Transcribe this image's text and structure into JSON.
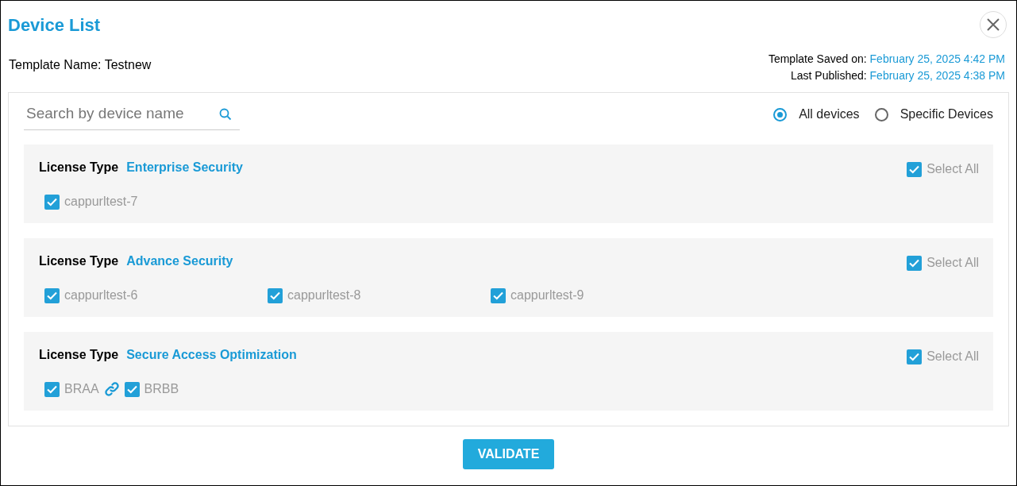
{
  "window": {
    "title": "Device List"
  },
  "template_name": {
    "label": "Template Name:",
    "value": "Testnew"
  },
  "template_saved": {
    "label": "Template Saved on:",
    "value": "February 25, 2025 4:42 PM"
  },
  "last_published": {
    "label": "Last Published:",
    "value": "February 25, 2025 4:38 PM"
  },
  "search": {
    "placeholder": "Search by device name"
  },
  "scope": [
    {
      "label": "All devices",
      "selected": true
    },
    {
      "label": "Specific Devices",
      "selected": false
    }
  ],
  "groups": [
    {
      "label": "License Type",
      "license": "Enterprise Security",
      "linked": false,
      "select_all": {
        "label": "Select All",
        "checked": true
      },
      "devices": [
        {
          "name": "cappurltest-7",
          "checked": true
        }
      ]
    },
    {
      "label": "License Type",
      "license": "Advance Security",
      "linked": false,
      "select_all": {
        "label": "Select All",
        "checked": true
      },
      "devices": [
        {
          "name": "cappurltest-6",
          "checked": true
        },
        {
          "name": "cappurltest-8",
          "checked": true
        },
        {
          "name": "cappurltest-9",
          "checked": true
        }
      ]
    },
    {
      "label": "License Type",
      "license": "Secure Access Optimization",
      "linked": true,
      "select_all": {
        "label": "Select All",
        "checked": true
      },
      "devices": [
        {
          "name": "BRAA",
          "checked": true
        },
        {
          "name": "BRBB",
          "checked": true
        }
      ]
    }
  ],
  "buttons": [
    "VALIDATE"
  ]
}
